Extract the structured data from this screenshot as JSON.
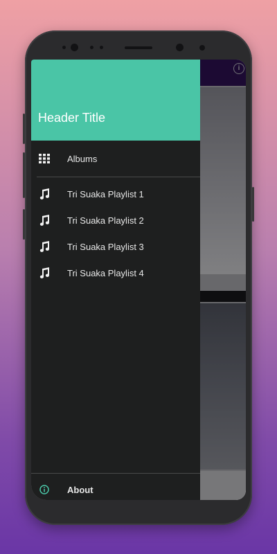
{
  "drawer": {
    "header_title": "Header Title",
    "albums_label": "Albums",
    "playlists": [
      {
        "label": "Tri Suaka Playlist 1"
      },
      {
        "label": "Tri Suaka Playlist 2"
      },
      {
        "label": "Tri Suaka Playlist 3"
      },
      {
        "label": "Tri Suaka Playlist 4"
      }
    ],
    "about_label": "About",
    "icons": {
      "albums": "grid-icon",
      "playlist": "music-note-icon",
      "about": "info-icon"
    }
  },
  "background_app": {
    "info_icon": "info-icon"
  },
  "colors": {
    "header": "#4ac5a6",
    "drawer_bg": "#1e1f1f",
    "toolbar": "#33135e",
    "about_icon": "#4ac5a6"
  }
}
